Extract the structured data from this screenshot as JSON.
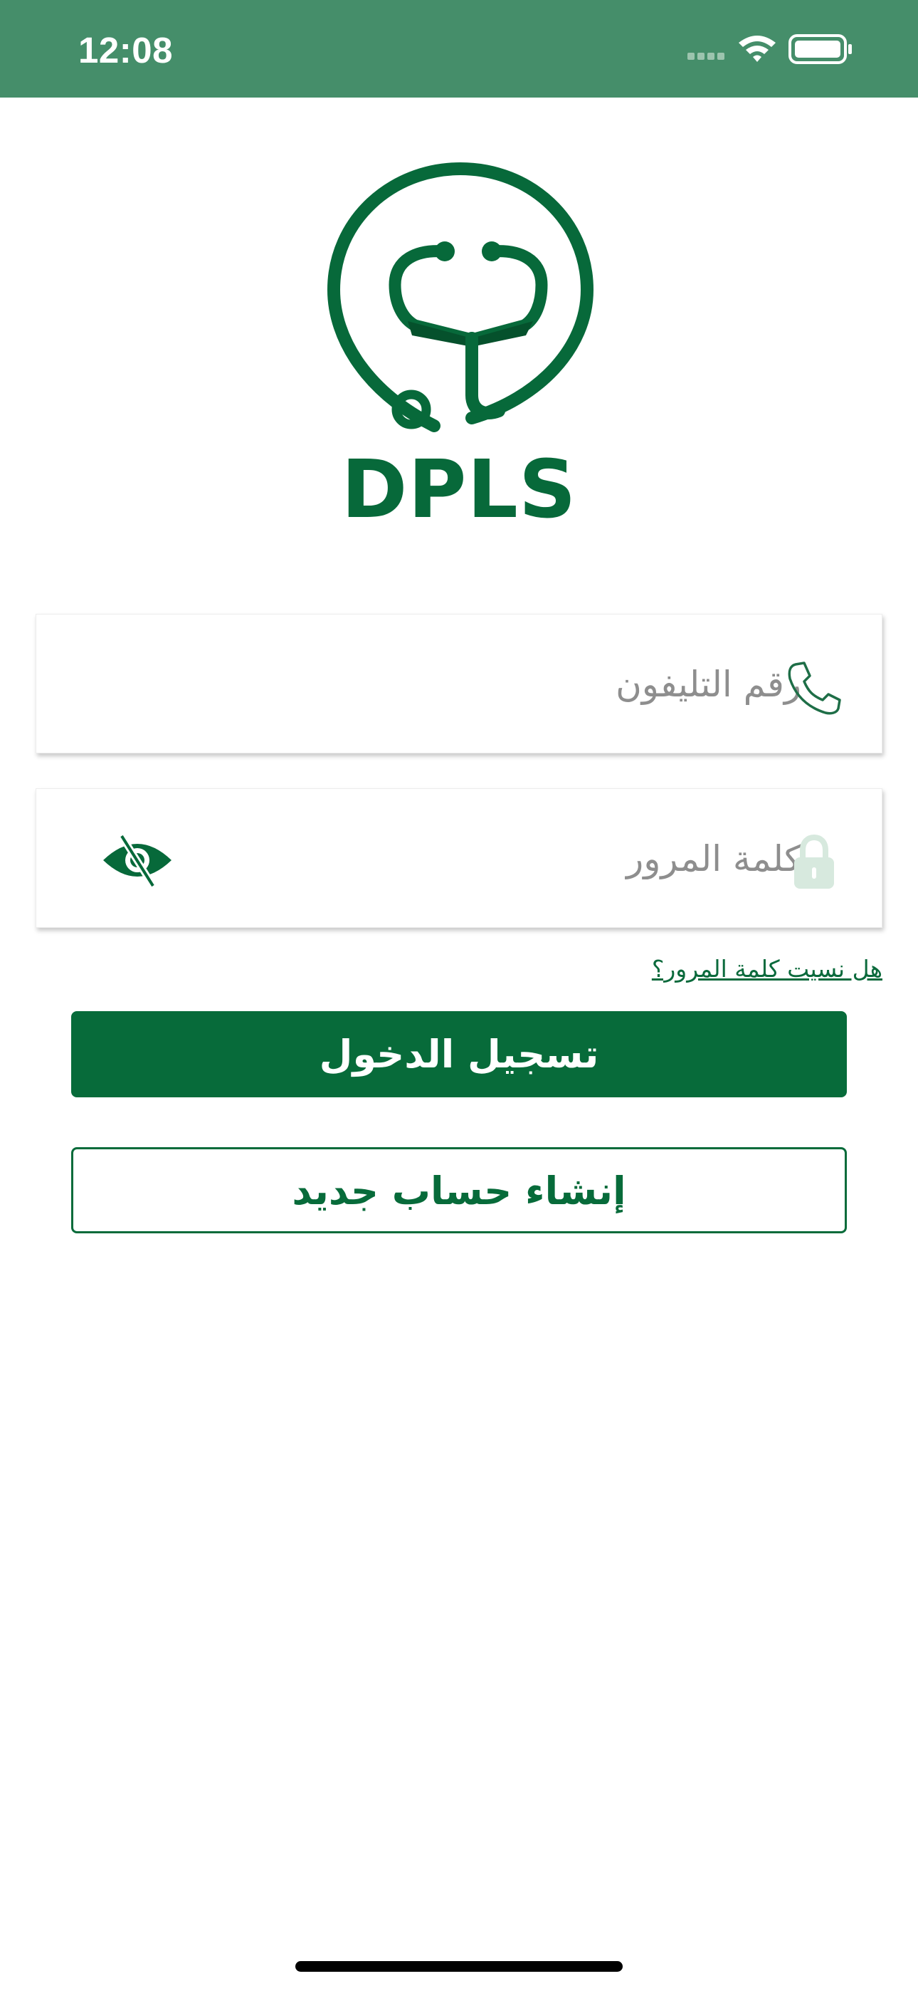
{
  "status_bar": {
    "time": "12:08",
    "icons": [
      "cellular-signal-icon",
      "wifi-icon",
      "battery-icon"
    ]
  },
  "logo": {
    "text": "DPLS",
    "icon": "stethoscope-logo-icon"
  },
  "phone_field": {
    "placeholder": "رقم التليفون",
    "value": "",
    "icon": "phone-icon"
  },
  "password_field": {
    "placeholder": "كلمة المرور",
    "value": "",
    "icon": "lock-icon",
    "visibility_icon": "eye-slash-icon"
  },
  "forgot_password": {
    "label": "هل نسيت كلمة المرور؟"
  },
  "login_button": {
    "label": "تسجيل الدخول"
  },
  "signup_button": {
    "label": "إنشاء حساب جديد"
  },
  "colors": {
    "status_bar": "#458e6a",
    "brand_green": "#076b3a",
    "lock_icon": "#d7e9de"
  }
}
